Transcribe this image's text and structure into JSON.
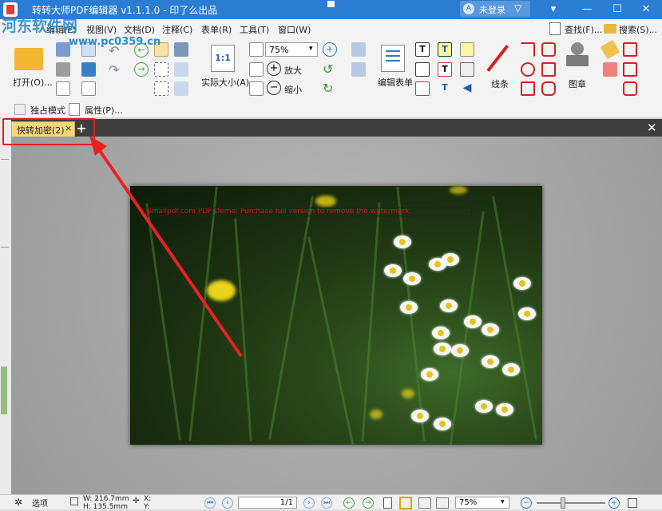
{
  "window": {
    "title": "转转大师PDF编辑器 v1.1.1.0 - 印了么出品",
    "login_label": "未登录",
    "avatar_letter": "A",
    "minimize": "—",
    "maximize": "☐",
    "close": "✕",
    "pin": "▽"
  },
  "watermark": {
    "site": "河东软件网",
    "url": "www.pc0359.cn"
  },
  "menu": {
    "items": [
      "编辑(E)",
      "视图(V)",
      "文档(D)",
      "注释(C)",
      "表单(R)",
      "工具(T)",
      "窗口(W)"
    ],
    "find": "查找(F)...",
    "search": "搜索(S)..."
  },
  "ribbon": {
    "open": "打开(O)...",
    "actual_size": "实际大小(A)",
    "actual_size_icon": "1:1",
    "zoom_value": "75%",
    "zoom_in": "放大",
    "zoom_out": "缩小",
    "edit_form": "编辑表单",
    "lines": "线条",
    "stamp": "图章",
    "exclusive_mode": "独占模式",
    "properties": "属性(P)..."
  },
  "tabs": {
    "active_label": "快转加密(2)",
    "close": "×",
    "add": "+",
    "panel_close": "✕"
  },
  "document": {
    "watermark_text": "Smallpdf.com PDF Demo: Purchase full version to remove the watermark"
  },
  "status": {
    "options": "选项",
    "width": "W: 216.7mm",
    "height": "H: 135.5mm",
    "x": "X:",
    "y": "Y:",
    "page": "1/1",
    "zoom": "75%"
  },
  "colors": {
    "titlebar": "#2b7cd3",
    "tab_active": "#f5d77a",
    "highlight": "#e02020"
  }
}
